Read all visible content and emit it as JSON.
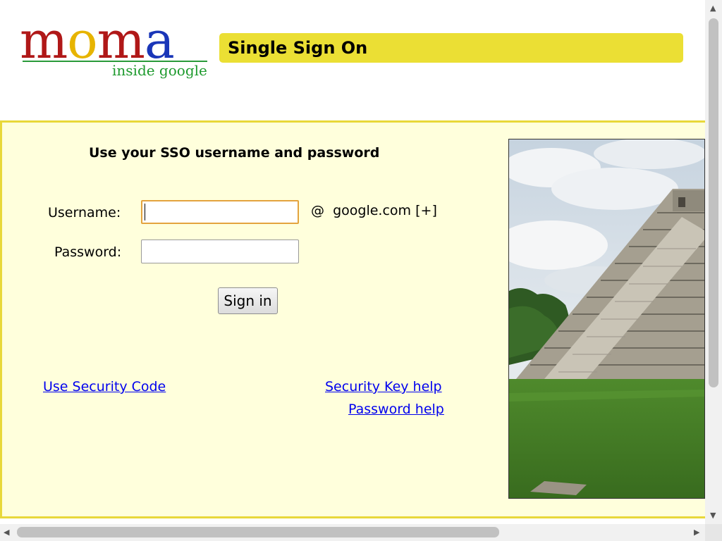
{
  "header": {
    "logo": {
      "word": [
        "m",
        "o",
        "m",
        "a"
      ],
      "tagline": "inside google"
    },
    "title": "Single Sign On"
  },
  "form": {
    "heading": "Use your SSO username and password",
    "username_label": "Username:",
    "username_value": "",
    "domain_prefix": "@",
    "domain": "google.com",
    "domain_expand": "[+]",
    "password_label": "Password:",
    "password_value": "",
    "submit_label": "Sign in"
  },
  "links": {
    "security_code": "Use Security Code",
    "security_key_help": "Security Key help",
    "password_help": "Password help"
  },
  "colors": {
    "title_bar": "#ebdf34",
    "panel_bg": "#ffffdc",
    "panel_border": "#e8d83a",
    "link": "#0000ee",
    "logo_letters": [
      "#b01818",
      "#e7b400",
      "#b01818",
      "#1a36b8"
    ]
  },
  "icons": {
    "scroll_up": "triangle-up",
    "scroll_down": "triangle-down",
    "scroll_left": "triangle-left",
    "scroll_right": "triangle-right"
  }
}
